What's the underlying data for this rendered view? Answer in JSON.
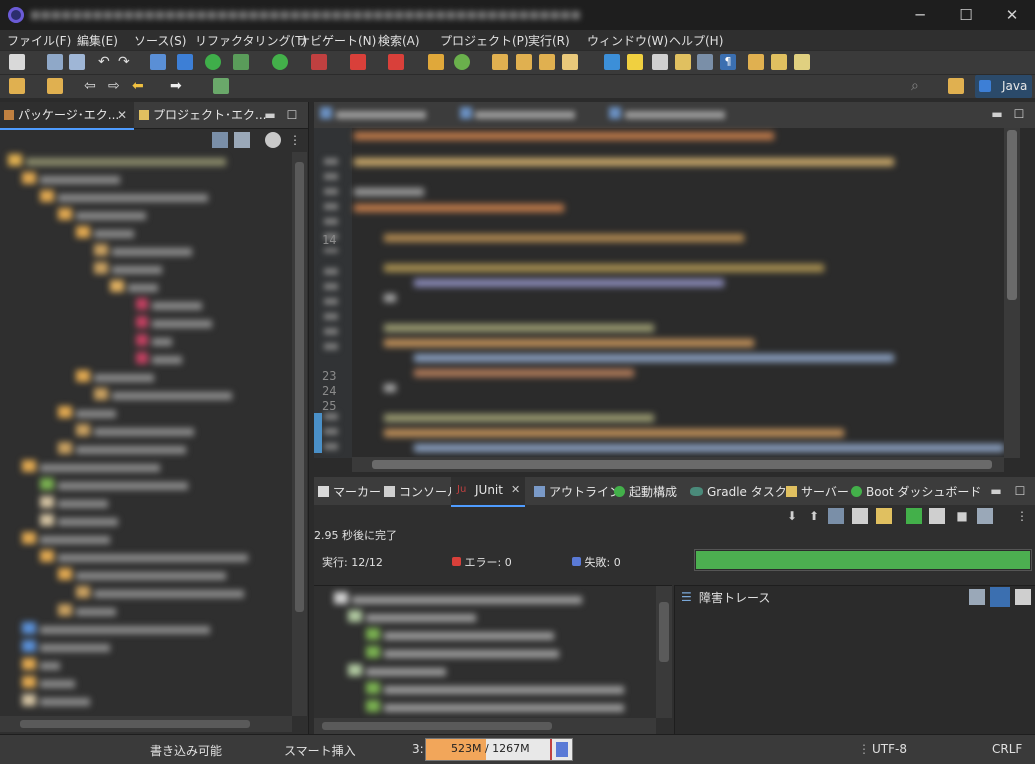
{
  "menu": [
    "ファイル(F)",
    "編集(E)",
    "ソース(S)",
    "リファクタリング(T)",
    "ナビゲート(N)",
    "検索(A)",
    "プロジェクト(P)",
    "実行(R)",
    "ウィンドウ(W)",
    "ヘルプ(H)"
  ],
  "perspective": {
    "label": "Java"
  },
  "left_tabs": {
    "package_explorer": "パッケージ･エク...",
    "project_explorer": "プロジェクト･エク..."
  },
  "line_numbers": [
    "14",
    "23",
    "24",
    "25"
  ],
  "bottom_tabs": {
    "markers": "マーカー",
    "console": "コンソール",
    "junit": "JUnit",
    "outline": "アウトライン",
    "launch": "起動構成",
    "gradle": "Gradle タスク",
    "servers": "サーバー",
    "boot_dashboard": "Boot ダッシュボード"
  },
  "junit": {
    "finished": "2.95 秒後に完了",
    "runs_label": "実行:",
    "runs_value": "12/12",
    "errors_label": "エラー:",
    "errors_value": "0",
    "failures_label": "失敗:",
    "failures_value": "0",
    "progress": 1.0,
    "failure_trace_label": "障害トレース"
  },
  "status": {
    "writable": "書き込み可能",
    "insert_mode": "スマート挿入",
    "position_prefix": "3:",
    "heap": "523M / 1267M",
    "encoding": "UTF-8",
    "line_delimiter": "CRLF"
  },
  "colors": {
    "progress_green": "#4caf50",
    "accent_blue": "#4f9cff",
    "heap_orange": "#f2a65a"
  }
}
